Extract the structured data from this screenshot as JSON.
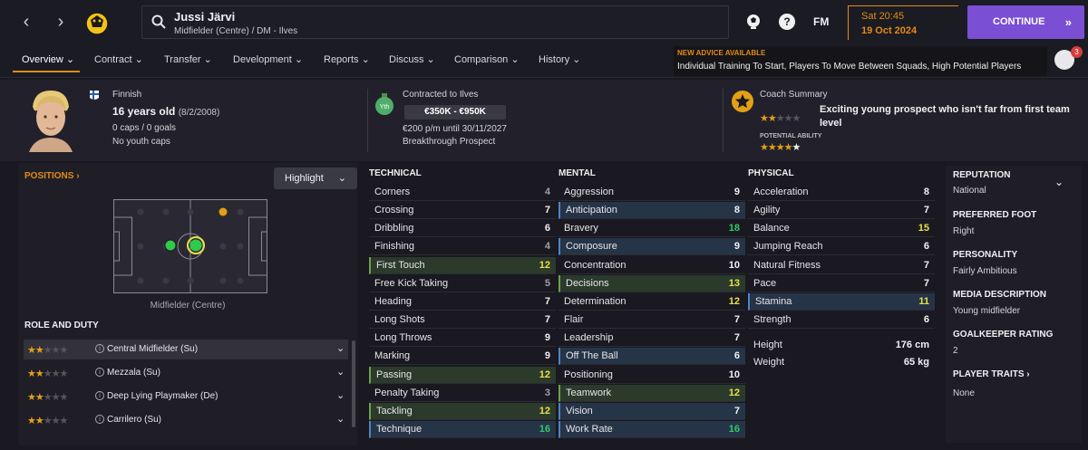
{
  "topbar": {
    "back_icon": "chevron-left-icon",
    "forward_icon": "chevron-right-icon",
    "player_name": "Jussi Järvi",
    "player_sub": "Midfielder (Centre) / DM - Ilves",
    "fm_label": "FM",
    "time": "Sat 20:45",
    "date": "19 Oct 2024",
    "continue_label": "CONTINUE",
    "advice_title": "NEW ADVICE AVAILABLE",
    "advice_text": "Individual Training To Start, Players To Move Between Squads, High Potential Players",
    "advice_count": "3",
    "accent": "#e38a16",
    "continue_color": "#7a4fd4"
  },
  "tabs": [
    {
      "label": "Overview ⌄"
    },
    {
      "label": "Contract ⌄"
    },
    {
      "label": "Transfer ⌄"
    },
    {
      "label": "Development ⌄"
    },
    {
      "label": "Reports ⌄"
    },
    {
      "label": "Discuss ⌄"
    },
    {
      "label": "Comparison ⌄"
    },
    {
      "label": "History ⌄"
    }
  ],
  "header": {
    "nationality": "Finnish",
    "age": "16 years old",
    "dob": "(8/2/2008)",
    "caps": "0 caps / 0 goals",
    "youth_caps": "No youth caps",
    "contract": "Contracted to Ilves",
    "yth_label": "Yth",
    "value": "€350K - €950K",
    "wage": "€200 p/m until 30/11/2027",
    "prospect": "Breakthrough Prospect",
    "coach_title": "Coach Summary",
    "coach_text": "Exciting young prospect who isn't far from first team level",
    "potential_label": "POTENTIAL ABILITY",
    "current_ability_stars": 2,
    "potential_ability_stars": 4.5
  },
  "positions": {
    "link": "POSITIONS ›",
    "highlight": "Highlight",
    "caption": "Midfielder (Centre)"
  },
  "roles": {
    "heading": "ROLE AND DUTY",
    "items": [
      {
        "label": "Central Midfielder (Su)",
        "stars": 2
      },
      {
        "label": "Mezzala (Su)",
        "stars": 2
      },
      {
        "label": "Deep Lying Playmaker (De)",
        "stars": 2
      },
      {
        "label": "Carrilero (Su)",
        "stars": 2
      }
    ]
  },
  "technical": {
    "heading": "TECHNICAL",
    "rows": [
      {
        "name": "Corners",
        "val": "4"
      },
      {
        "name": "Crossing",
        "val": "7"
      },
      {
        "name": "Dribbling",
        "val": "6"
      },
      {
        "name": "Finishing",
        "val": "4"
      },
      {
        "name": "First Touch",
        "val": "12"
      },
      {
        "name": "Free Kick Taking",
        "val": "5"
      },
      {
        "name": "Heading",
        "val": "7"
      },
      {
        "name": "Long Shots",
        "val": "7"
      },
      {
        "name": "Long Throws",
        "val": "9"
      },
      {
        "name": "Marking",
        "val": "9"
      },
      {
        "name": "Passing",
        "val": "12"
      },
      {
        "name": "Penalty Taking",
        "val": "3"
      },
      {
        "name": "Tackling",
        "val": "12"
      },
      {
        "name": "Technique",
        "val": "16"
      }
    ]
  },
  "mental": {
    "heading": "MENTAL",
    "rows": [
      {
        "name": "Aggression",
        "val": "9"
      },
      {
        "name": "Anticipation",
        "val": "8"
      },
      {
        "name": "Bravery",
        "val": "18"
      },
      {
        "name": "Composure",
        "val": "9"
      },
      {
        "name": "Concentration",
        "val": "10"
      },
      {
        "name": "Decisions",
        "val": "13"
      },
      {
        "name": "Determination",
        "val": "12"
      },
      {
        "name": "Flair",
        "val": "7"
      },
      {
        "name": "Leadership",
        "val": "7"
      },
      {
        "name": "Off The Ball",
        "val": "6"
      },
      {
        "name": "Positioning",
        "val": "10"
      },
      {
        "name": "Teamwork",
        "val": "12"
      },
      {
        "name": "Vision",
        "val": "7"
      },
      {
        "name": "Work Rate",
        "val": "16"
      }
    ]
  },
  "physical": {
    "heading": "PHYSICAL",
    "rows": [
      {
        "name": "Acceleration",
        "val": "8"
      },
      {
        "name": "Agility",
        "val": "7"
      },
      {
        "name": "Balance",
        "val": "15"
      },
      {
        "name": "Jumping Reach",
        "val": "6"
      },
      {
        "name": "Natural Fitness",
        "val": "7"
      },
      {
        "name": "Pace",
        "val": "7"
      },
      {
        "name": "Stamina",
        "val": "11"
      },
      {
        "name": "Strength",
        "val": "6"
      }
    ],
    "height_label": "Height",
    "height": "176 cm",
    "weight_label": "Weight",
    "weight": "65 kg"
  },
  "info": {
    "reputation_title": "REPUTATION",
    "reputation": "National",
    "foot_title": "PREFERRED FOOT",
    "foot": "Right",
    "personality_title": "PERSONALITY",
    "personality": "Fairly Ambitious",
    "media_title": "MEDIA DESCRIPTION",
    "media": "Young midfielder",
    "gk_title": "GOALKEEPER RATING",
    "gk": "2",
    "traits_title": "PLAYER TRAITS ›",
    "traits": "None"
  }
}
